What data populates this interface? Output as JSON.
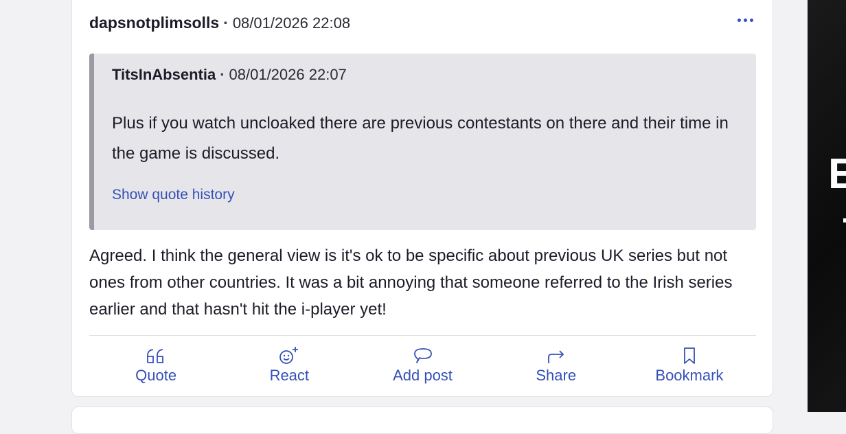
{
  "post": {
    "author": "dapsnotplimsolls",
    "separator": "·",
    "timestamp": "08/01/2026 22:08",
    "more_label": "More options",
    "quote": {
      "author": "TitsInAbsentia",
      "separator": "·",
      "timestamp": "08/01/2026 22:07",
      "text": "Plus if you watch uncloaked there are previous contestants on there and their time in the game is discussed.",
      "history_link": "Show quote history"
    },
    "body": "Agreed. I think the general view is it's ok to be specific about previous UK series but not ones from other countries. It was a bit annoying that someone referred to the Irish series earlier and that hasn't hit the i-player yet!",
    "actions": [
      {
        "label": "Quote",
        "icon": "quote-icon"
      },
      {
        "label": "React",
        "icon": "react-emoji-icon"
      },
      {
        "label": "Add post",
        "icon": "speech-bubble-icon"
      },
      {
        "label": "Share",
        "icon": "share-arrow-icon"
      },
      {
        "label": "Bookmark",
        "icon": "bookmark-icon"
      }
    ]
  },
  "side_panel": {
    "letter": "E"
  },
  "colors": {
    "accent": "#3550b8",
    "quote_background": "#e6e6ea",
    "quote_border": "#9a9aa3",
    "page_background": "#f2f2f4"
  }
}
